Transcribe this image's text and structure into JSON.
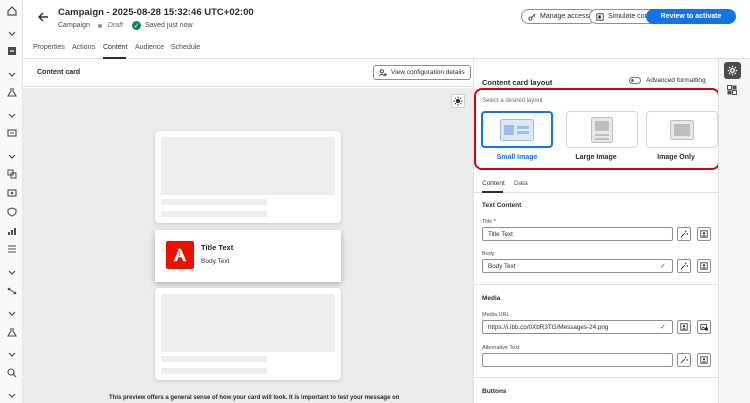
{
  "header": {
    "title": "Campaign - 2025-08-28 15:32:46 UTC+02:00",
    "type": "Campaign",
    "status": "Draft",
    "saved": "Saved just now",
    "manage_access": "Manage access",
    "simulate_content": "Simulate content",
    "review_activate": "Review to activate"
  },
  "tabs": [
    "Properties",
    "Actions",
    "Content",
    "Audience",
    "Schedule"
  ],
  "preview": {
    "label": "Content card",
    "config_button": "View configuration details",
    "card_title": "Title Text",
    "card_body": "Body Text",
    "note": "This preview offers a general sense of how your card will look. It is important to test your message on"
  },
  "panel": {
    "title": "Content card layout",
    "advanced": "Advanced formatting",
    "hint": "Select a desired layout",
    "layouts": [
      "Small Image",
      "Large Image",
      "Image Only"
    ],
    "subtabs": [
      "Content",
      "Data"
    ],
    "text_content": "Text Content",
    "title_label": "Title",
    "title_value": "Title Text",
    "body_label": "Body",
    "body_value": "Body Text",
    "media": "Media",
    "media_url_label": "Media URL",
    "media_url_value": "https://i.ibb.co/0XbR3TG/Messages-24.png",
    "alt_label": "Alternative Text",
    "alt_value": "",
    "buttons": "Buttons"
  },
  "colors": {
    "accent": "#1473e6",
    "highlight": "#d9000d",
    "success": "#12805c",
    "brand": "#eb1000"
  }
}
